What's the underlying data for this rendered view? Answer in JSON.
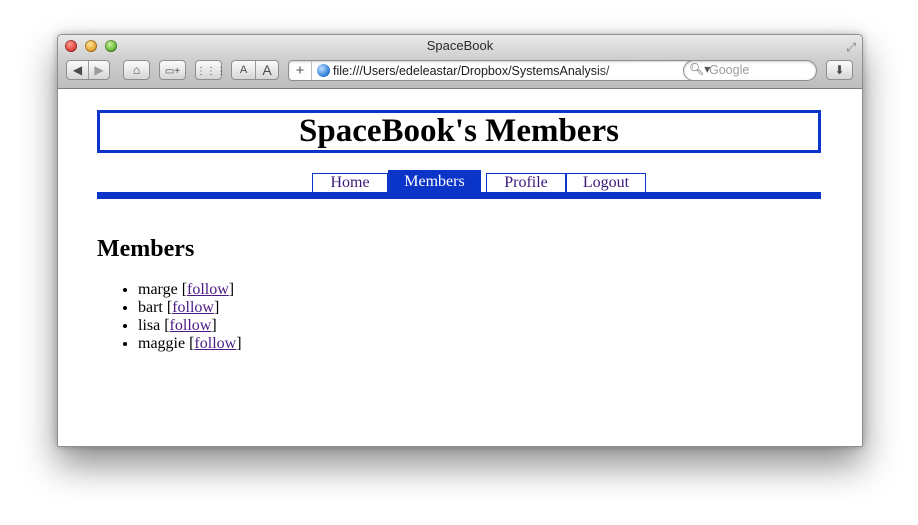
{
  "window": {
    "title": "SpaceBook"
  },
  "toolbar": {
    "address": "file:///Users/edeleastar/Dropbox/SystemsAnalysis/",
    "search_placeholder": "Google"
  },
  "page": {
    "banner_title": "SpaceBook's Members",
    "tabs": [
      {
        "label": "Home",
        "active": false
      },
      {
        "label": "Members",
        "active": true
      },
      {
        "label": "Profile",
        "active": false
      },
      {
        "label": "Logout",
        "active": false
      }
    ],
    "section_title": "Members",
    "members": [
      {
        "name": "marge",
        "action": "follow"
      },
      {
        "name": "bart",
        "action": "follow"
      },
      {
        "name": "lisa",
        "action": "follow"
      },
      {
        "name": "maggie",
        "action": "follow"
      }
    ]
  },
  "colors": {
    "accent": "#0a35c8",
    "link": "#4b1a86"
  }
}
